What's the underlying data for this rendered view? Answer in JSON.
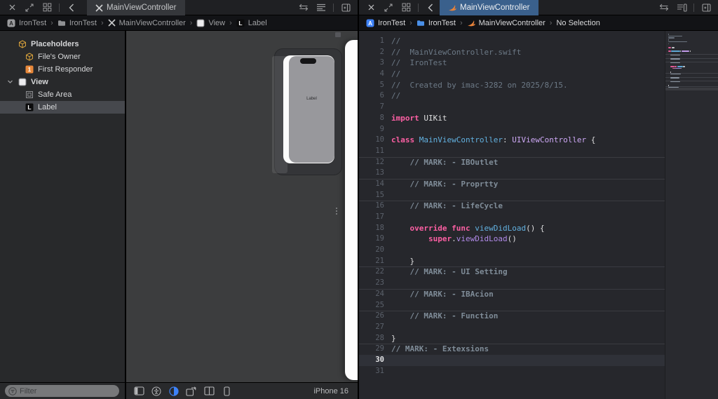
{
  "colors": {
    "accent_blue": "#3E82F7",
    "tab_selected_blue": "#3A608C",
    "swift_orange": "#F05138",
    "placeholder_yellow": "#D9A23B",
    "responder_orange": "#E8883A",
    "editor_bg": "#26272C",
    "canvas_bg": "#3C3D3E"
  },
  "left_pane": {
    "toolbar": {
      "tab_title": "MainViewController"
    },
    "breadcrumb": {
      "project": "IronTest",
      "group": "IronTest",
      "file": "MainViewController",
      "view": "View",
      "element": "Label"
    },
    "outline": {
      "rows": [
        {
          "label": "Placeholders",
          "icon": "cube",
          "level": 1,
          "bold": true
        },
        {
          "label": "File's Owner",
          "icon": "cube",
          "level": 2
        },
        {
          "label": "First Responder",
          "icon": "responder",
          "level": 2,
          "badge": "1"
        },
        {
          "label": "View",
          "icon": "view",
          "level": 1,
          "bold": true,
          "disclosure": true
        },
        {
          "label": "Safe Area",
          "icon": "safearea",
          "level": 2
        },
        {
          "label": "Label",
          "icon": "label",
          "level": 2,
          "selected": true
        }
      ]
    },
    "canvas": {
      "screen_label": "Label"
    },
    "statusbar": {
      "filter_placeholder": "Filter",
      "device_name": "iPhone 16"
    }
  },
  "right_pane": {
    "toolbar": {
      "tab_title": "MainViewController"
    },
    "breadcrumb": {
      "project": "IronTest",
      "group": "IronTest",
      "file": "MainViewController",
      "selection": "No Selection"
    },
    "editor": {
      "current_line": 30,
      "lines": [
        {
          "n": 1,
          "seg": [
            [
              "com",
              "//"
            ]
          ]
        },
        {
          "n": 2,
          "seg": [
            [
              "com",
              "//  MainViewController.swift"
            ]
          ]
        },
        {
          "n": 3,
          "seg": [
            [
              "com",
              "//  IronTest"
            ]
          ]
        },
        {
          "n": 4,
          "seg": [
            [
              "com",
              "//"
            ]
          ]
        },
        {
          "n": 5,
          "seg": [
            [
              "com",
              "//  Created by imac-3282 on 2025/8/15."
            ]
          ]
        },
        {
          "n": 6,
          "seg": [
            [
              "com",
              "//"
            ]
          ]
        },
        {
          "n": 7,
          "seg": []
        },
        {
          "n": 8,
          "seg": [
            [
              "kw",
              "import"
            ],
            [
              "pl",
              " UIKit"
            ]
          ]
        },
        {
          "n": 9,
          "seg": []
        },
        {
          "n": 10,
          "seg": [
            [
              "kw",
              "class"
            ],
            [
              "pl",
              " "
            ],
            [
              "ty",
              "MainViewController"
            ],
            [
              "pl",
              ": "
            ],
            [
              "ex",
              "UIViewController"
            ],
            [
              "pl",
              " {"
            ]
          ]
        },
        {
          "n": 11,
          "seg": []
        },
        {
          "n": 12,
          "sep": true,
          "seg": [
            [
              "pl",
              "    "
            ],
            [
              "mark",
              "// MARK: - IBOutlet"
            ]
          ]
        },
        {
          "n": 13,
          "seg": []
        },
        {
          "n": 14,
          "sep": true,
          "seg": [
            [
              "pl",
              "    "
            ],
            [
              "mark",
              "// MARK: - Proprtty"
            ]
          ]
        },
        {
          "n": 15,
          "seg": []
        },
        {
          "n": 16,
          "sep": true,
          "seg": [
            [
              "pl",
              "    "
            ],
            [
              "mark",
              "// MARK: - LifeCycle"
            ]
          ]
        },
        {
          "n": 17,
          "seg": []
        },
        {
          "n": 18,
          "seg": [
            [
              "pl",
              "    "
            ],
            [
              "kw",
              "override"
            ],
            [
              "pl",
              " "
            ],
            [
              "kw",
              "func"
            ],
            [
              "pl",
              " "
            ],
            [
              "ty",
              "viewDidLoad"
            ],
            [
              "pl",
              "() {"
            ]
          ]
        },
        {
          "n": 19,
          "seg": [
            [
              "pl",
              "        "
            ],
            [
              "kw",
              "super"
            ],
            [
              "pl",
              "."
            ],
            [
              "mem",
              "viewDidLoad"
            ],
            [
              "pl",
              "()"
            ]
          ]
        },
        {
          "n": 20,
          "seg": []
        },
        {
          "n": 21,
          "seg": [
            [
              "pl",
              "    }"
            ]
          ]
        },
        {
          "n": 22,
          "sep": true,
          "seg": [
            [
              "pl",
              "    "
            ],
            [
              "mark",
              "// MARK: - UI Setting"
            ]
          ]
        },
        {
          "n": 23,
          "seg": []
        },
        {
          "n": 24,
          "sep": true,
          "seg": [
            [
              "pl",
              "    "
            ],
            [
              "mark",
              "// MARK: - IBAcion"
            ]
          ]
        },
        {
          "n": 25,
          "seg": []
        },
        {
          "n": 26,
          "sep": true,
          "seg": [
            [
              "pl",
              "    "
            ],
            [
              "mark",
              "// MARK: - Function"
            ]
          ]
        },
        {
          "n": 27,
          "seg": []
        },
        {
          "n": 28,
          "seg": [
            [
              "pl",
              "}"
            ]
          ]
        },
        {
          "n": 29,
          "sep": true,
          "seg": [
            [
              "mark",
              "// MARK: - Extexsions"
            ]
          ]
        },
        {
          "n": 30,
          "cur": true,
          "seg": []
        },
        {
          "n": 31,
          "seg": []
        }
      ]
    }
  }
}
